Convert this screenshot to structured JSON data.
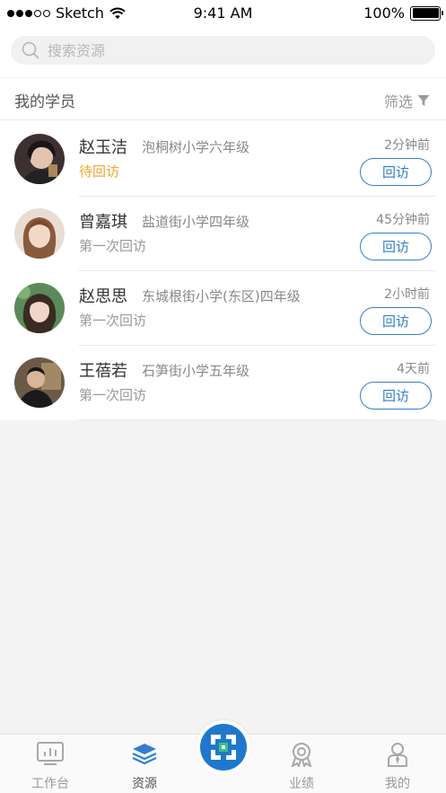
{
  "status_bar": {
    "carrier": "Sketch",
    "time": "9:41 AM",
    "battery": "100%"
  },
  "search": {
    "placeholder": "搜索资源"
  },
  "section": {
    "title": "我的学员",
    "filter_label": "筛选"
  },
  "students": [
    {
      "name": "赵玉洁",
      "school": "泡桐树小学六年级",
      "status": "待回访",
      "status_color": "#f5a623",
      "time": "2分钟前",
      "action": "回访"
    },
    {
      "name": "曾嘉琪",
      "school": "盐道街小学四年级",
      "status": "第一次回访",
      "status_color": "#999999",
      "time": "45分钟前",
      "action": "回访"
    },
    {
      "name": "赵思思",
      "school": "东城根街小学(东区)四年级",
      "status": "第一次回访",
      "status_color": "#999999",
      "time": "2小时前",
      "action": "回访"
    },
    {
      "name": "王蓓若",
      "school": "石笋街小学五年级",
      "status": "第一次回访",
      "status_color": "#999999",
      "time": "4天前",
      "action": "回访"
    }
  ],
  "tabbar": {
    "items": [
      {
        "label": "工作台",
        "icon": "dashboard-icon"
      },
      {
        "label": "资源",
        "icon": "layers-icon",
        "active": true
      },
      {
        "label": "",
        "icon": "scan-icon"
      },
      {
        "label": "业绩",
        "icon": "award-icon"
      },
      {
        "label": "我的",
        "icon": "person-icon"
      }
    ]
  },
  "colors": {
    "accent": "#2e7fd4",
    "pending": "#f5a623"
  }
}
